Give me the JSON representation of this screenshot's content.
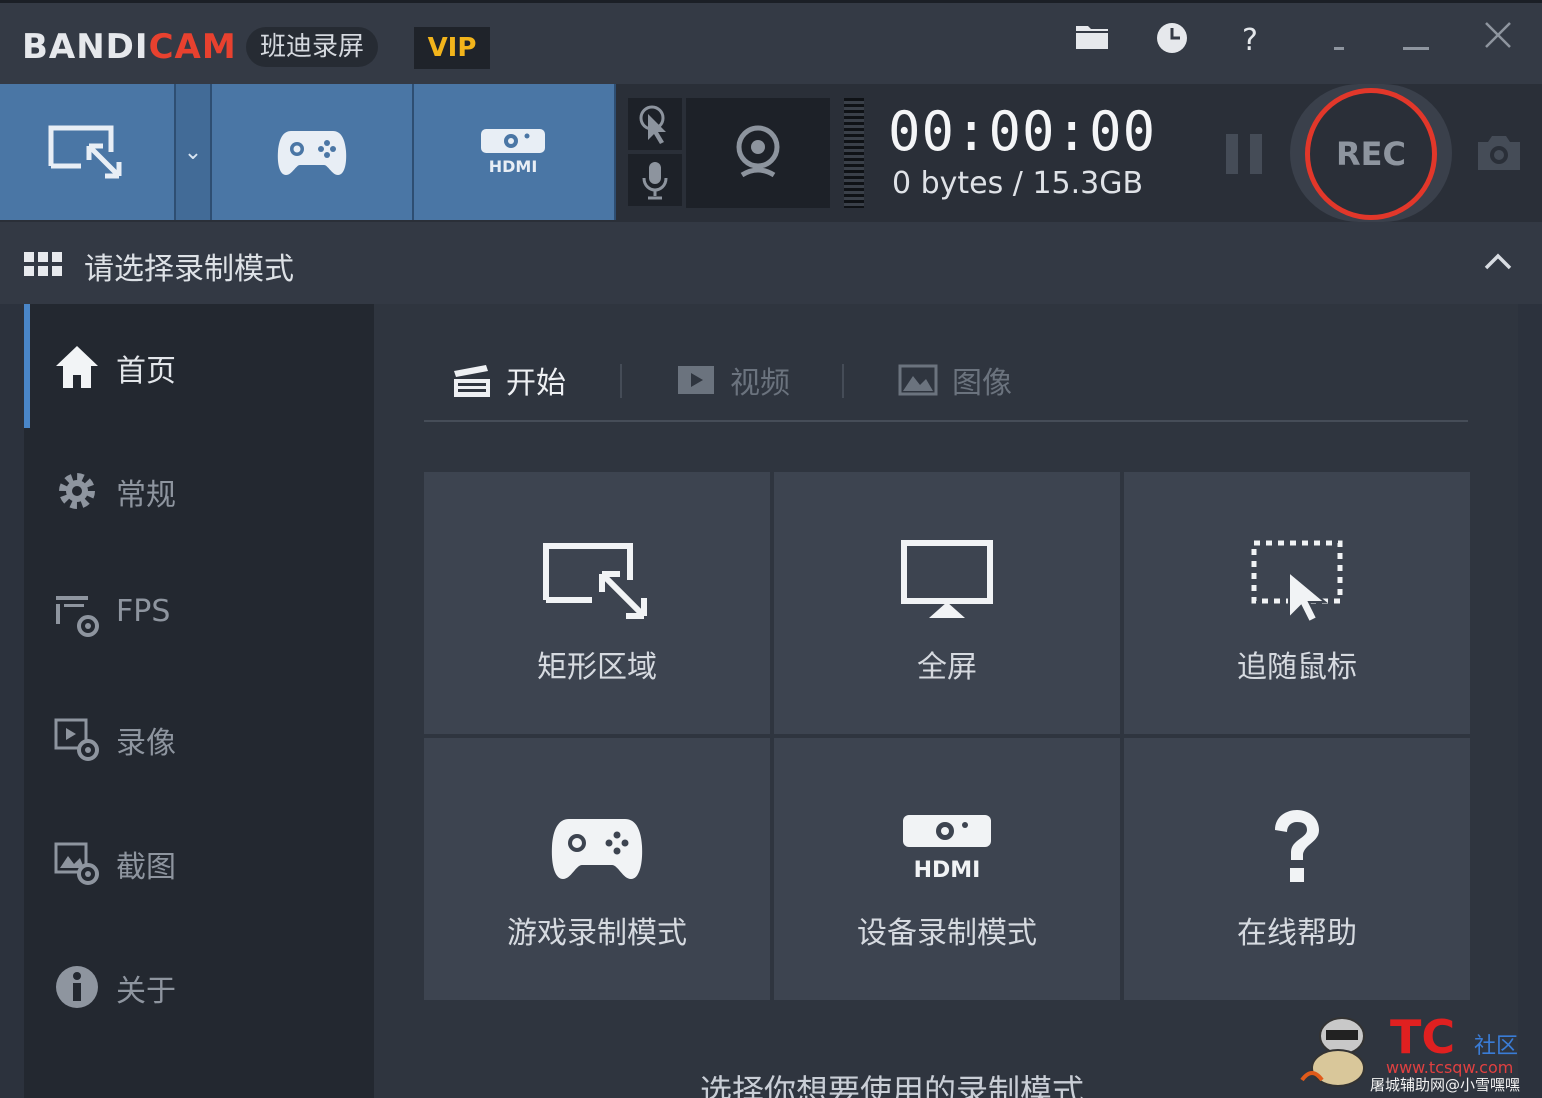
{
  "titlebar": {
    "logo_main": "BANDI",
    "logo_accent": "CAM",
    "subtitle": "班迪录屏",
    "vip_badge": "VIP",
    "icons": [
      "folder-icon",
      "clock-icon",
      "help-icon"
    ],
    "help_glyph": "?",
    "window_buttons": [
      "minimize-to-tray",
      "minimize",
      "close"
    ]
  },
  "toolbar": {
    "modes": [
      "rectangle-mode",
      "game-mode",
      "hdmi-device-mode"
    ],
    "dropdown_glyph": "⌄",
    "timer": "00:00:00",
    "size": "0 bytes / 15.3GB",
    "rec_label": "REC",
    "colors": {
      "mode_blue": "#4a76a5",
      "rec_red": "#e2372a"
    }
  },
  "modebar": {
    "title": "请选择录制模式",
    "collapse_glyph": "⌃"
  },
  "sidebar": {
    "items": [
      {
        "label": "首页",
        "icon": "home-icon",
        "active": true
      },
      {
        "label": "常规",
        "icon": "gear-icon"
      },
      {
        "label": "FPS",
        "icon": "fps-icon"
      },
      {
        "label": "录像",
        "icon": "video-settings-icon"
      },
      {
        "label": "截图",
        "icon": "image-settings-icon"
      },
      {
        "label": "关于",
        "icon": "info-icon"
      }
    ]
  },
  "tabs": [
    {
      "label": "开始",
      "icon": "clapperboard-icon",
      "active": true
    },
    {
      "label": "视频",
      "icon": "video-folder-icon"
    },
    {
      "label": "图像",
      "icon": "image-folder-icon"
    }
  ],
  "cards": [
    {
      "label": "矩形区域",
      "icon": "rectangle-area-icon"
    },
    {
      "label": "全屏",
      "icon": "fullscreen-monitor-icon"
    },
    {
      "label": "追随鼠标",
      "icon": "follow-mouse-icon"
    },
    {
      "label": "游戏录制模式",
      "icon": "gamepad-icon"
    },
    {
      "label": "设备录制模式",
      "icon": "hdmi-icon"
    },
    {
      "label": "在线帮助",
      "icon": "question-icon"
    }
  ],
  "bottom_text": "选择你想要使用的录制模式",
  "watermark": {
    "logo": "TC",
    "logo_suffix": "社区",
    "url": "www.tcsqw.com",
    "text": "屠城辅助网@小雪嘿嘿"
  }
}
